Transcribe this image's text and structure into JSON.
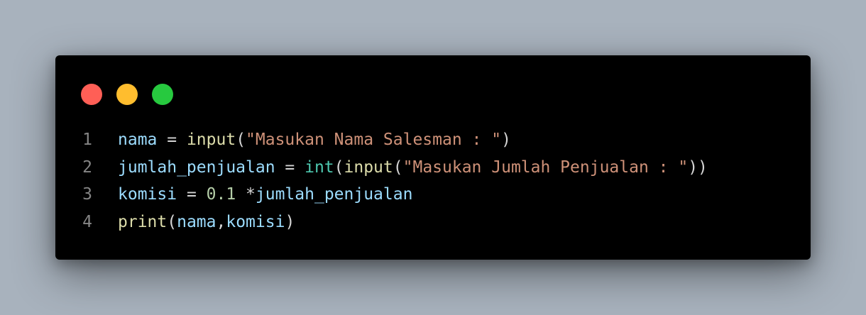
{
  "window": {
    "controls": {
      "close_color": "#ff5f56",
      "minimize_color": "#ffbd2e",
      "maximize_color": "#27c93f"
    }
  },
  "code": {
    "language": "python",
    "lines": [
      {
        "number": "1",
        "tokens": [
          {
            "type": "var",
            "text": "nama"
          },
          {
            "type": "op",
            "text": " = "
          },
          {
            "type": "fn",
            "text": "input"
          },
          {
            "type": "op",
            "text": "("
          },
          {
            "type": "str",
            "text": "\"Masukan Nama Salesman : \""
          },
          {
            "type": "op",
            "text": ")"
          }
        ]
      },
      {
        "number": "2",
        "tokens": [
          {
            "type": "var",
            "text": "jumlah_penjualan"
          },
          {
            "type": "op",
            "text": " = "
          },
          {
            "type": "typ",
            "text": "int"
          },
          {
            "type": "op",
            "text": "("
          },
          {
            "type": "fn",
            "text": "input"
          },
          {
            "type": "op",
            "text": "("
          },
          {
            "type": "str",
            "text": "\"Masukan Jumlah Penjualan : \""
          },
          {
            "type": "op",
            "text": "))"
          }
        ]
      },
      {
        "number": "3",
        "tokens": [
          {
            "type": "var",
            "text": "komisi"
          },
          {
            "type": "op",
            "text": " = "
          },
          {
            "type": "num",
            "text": "0.1"
          },
          {
            "type": "op",
            "text": " *"
          },
          {
            "type": "var",
            "text": "jumlah_penjualan"
          }
        ]
      },
      {
        "number": "4",
        "tokens": [
          {
            "type": "fn",
            "text": "print"
          },
          {
            "type": "op",
            "text": "("
          },
          {
            "type": "var",
            "text": "nama"
          },
          {
            "type": "op",
            "text": ","
          },
          {
            "type": "var",
            "text": "komisi"
          },
          {
            "type": "op",
            "text": ")"
          }
        ]
      }
    ]
  },
  "colors": {
    "background": "#a8b2bd",
    "window": "#000000",
    "variable": "#9cdcfe",
    "function": "#dcdcaa",
    "string": "#ce9178",
    "type": "#4ec9b0",
    "number": "#b5cea8",
    "line_number": "#858585"
  }
}
